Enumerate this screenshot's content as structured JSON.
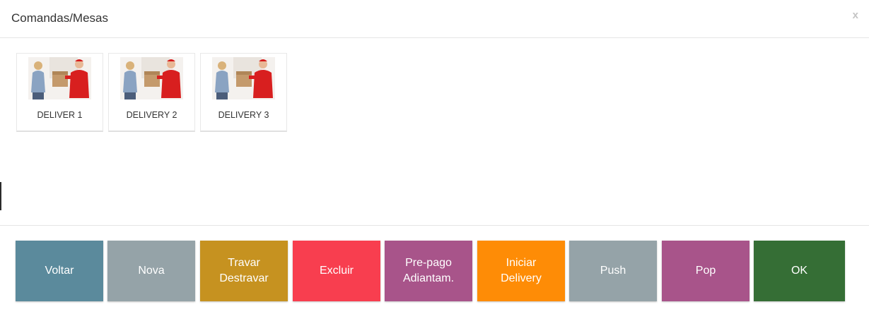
{
  "header": {
    "title": "Comandas/Mesas",
    "close_label": "x"
  },
  "tables": [
    {
      "label": "DELIVER 1"
    },
    {
      "label": "DELIVERY 2"
    },
    {
      "label": "DELIVERY 3"
    }
  ],
  "buttons": [
    {
      "label": "Voltar",
      "color": "#5b8a9c"
    },
    {
      "label": "Nova",
      "color": "#95a3a8"
    },
    {
      "label": "Travar\nDestravar",
      "color": "#c69220"
    },
    {
      "label": "Excluir",
      "color": "#f83e4f"
    },
    {
      "label": "Pre-pago\nAdiantam.",
      "color": "#a8548a"
    },
    {
      "label": "Iniciar\nDelivery",
      "color": "#fe8c06"
    },
    {
      "label": "Push",
      "color": "#95a3a8"
    },
    {
      "label": "Pop",
      "color": "#a8548a"
    },
    {
      "label": "OK",
      "color": "#356e35"
    }
  ]
}
